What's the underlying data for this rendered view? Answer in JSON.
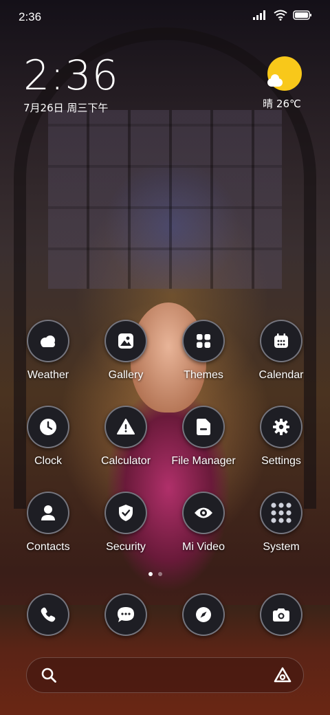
{
  "status_bar": {
    "time": "2:36"
  },
  "clock_widget": {
    "time": "2:36",
    "date": "7月26日 周三下午"
  },
  "weather_widget": {
    "text": "晴 26℃",
    "icon": "sunny-partly-cloudy-icon",
    "sun_color": "#f8c81a"
  },
  "apps": [
    {
      "label": "Weather",
      "icon": "weather-cloud-icon"
    },
    {
      "label": "Gallery",
      "icon": "gallery-icon"
    },
    {
      "label": "Themes",
      "icon": "themes-icon"
    },
    {
      "label": "Calendar",
      "icon": "calendar-icon"
    },
    {
      "label": "Clock",
      "icon": "clock-icon"
    },
    {
      "label": "Calculator",
      "icon": "calculator-warning-icon"
    },
    {
      "label": "File Manager",
      "icon": "file-manager-icon"
    },
    {
      "label": "Settings",
      "icon": "gear-icon"
    },
    {
      "label": "Contacts",
      "icon": "contacts-icon"
    },
    {
      "label": "Security",
      "icon": "security-shield-icon"
    },
    {
      "label": "Mi Video",
      "icon": "video-eye-icon"
    },
    {
      "label": "System",
      "icon": "folder-grid-icon"
    }
  ],
  "dock": [
    {
      "icon": "phone-icon"
    },
    {
      "icon": "messaging-icon"
    },
    {
      "icon": "browser-compass-icon"
    },
    {
      "icon": "camera-icon"
    }
  ],
  "page_indicator": {
    "pages": 2,
    "current": 1
  },
  "search_bar": {
    "icon": "search-icon",
    "right_icon": "assistant-icon"
  }
}
